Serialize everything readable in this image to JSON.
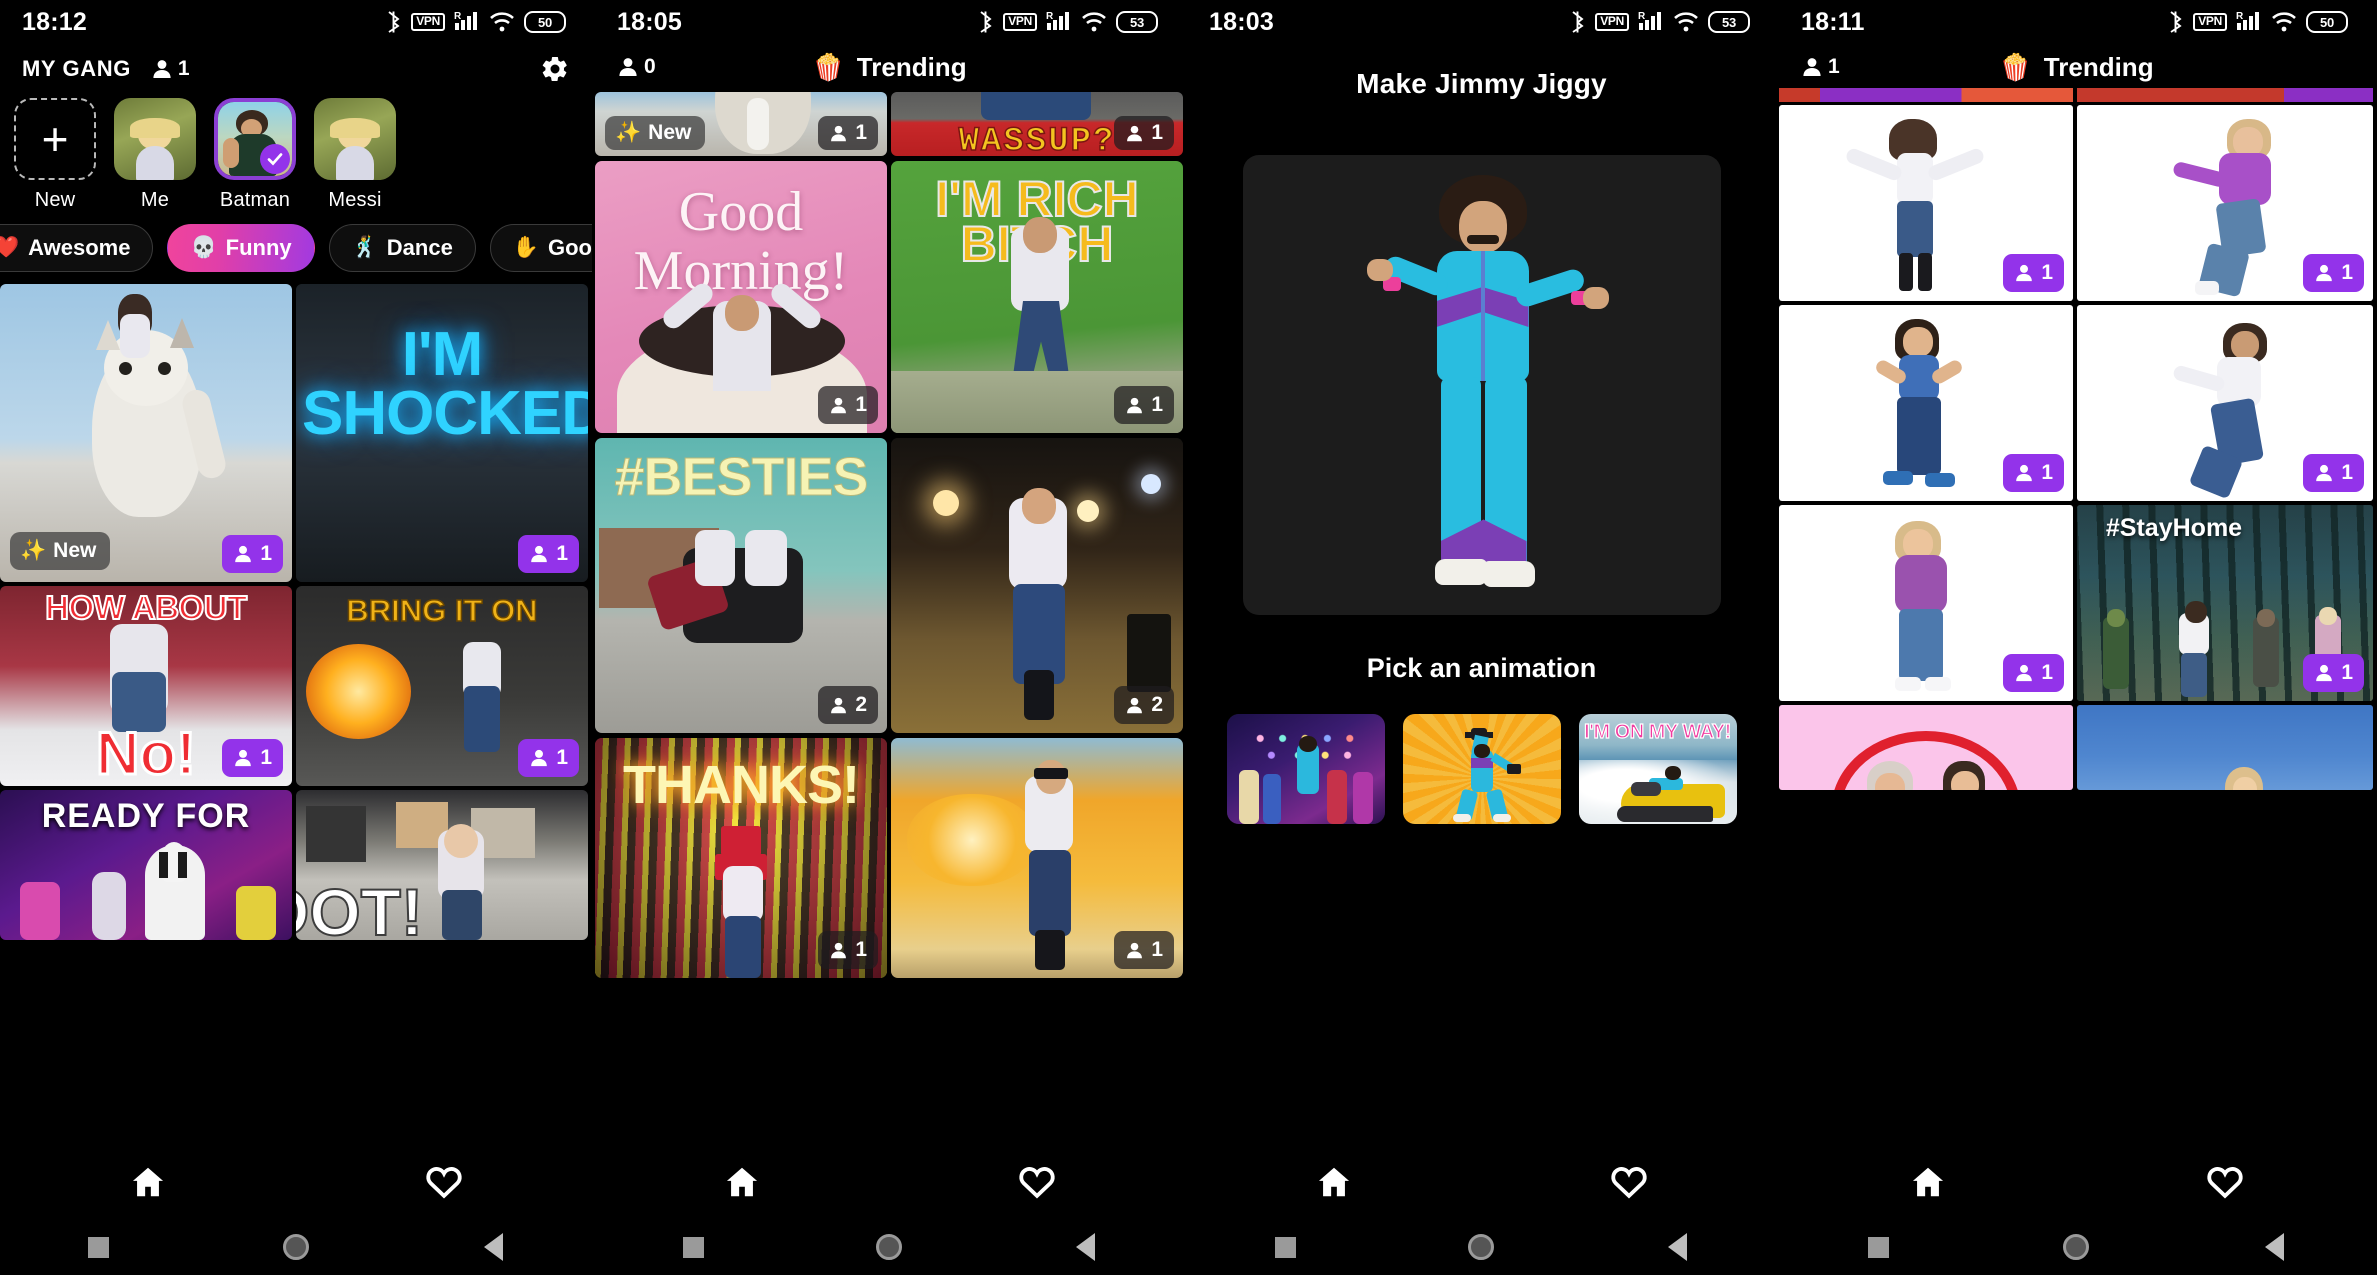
{
  "panels": [
    {
      "id": "my-gang",
      "statusbar": {
        "time": "18:12",
        "battery": "50",
        "vpn": "VPN",
        "roaming": "R",
        "icons": [
          "bluetooth-icon",
          "vpn-icon",
          "signal-icon",
          "wifi-icon",
          "battery-icon"
        ]
      },
      "header": {
        "title": "MY GANG",
        "member_count": "1",
        "gear": "gear-icon"
      },
      "avatars": [
        {
          "label": "New",
          "type": "add",
          "selected": false
        },
        {
          "label": "Me",
          "type": "photo",
          "selected": false
        },
        {
          "label": "Batman",
          "type": "photo",
          "selected": true
        },
        {
          "label": "Messi",
          "type": "photo",
          "selected": false
        }
      ],
      "chips": [
        {
          "label": "Awesome",
          "emoji": "❤️",
          "active": false
        },
        {
          "label": "Funny",
          "emoji": "💀",
          "active": true
        },
        {
          "label": "Dance",
          "emoji": "🕺",
          "active": false
        },
        {
          "label": "Good",
          "emoji": "✋",
          "active": false
        }
      ],
      "tiles": [
        {
          "caption": "",
          "scene": "cat-snow",
          "count": "1",
          "new": "New",
          "badge": "purple"
        },
        {
          "caption": "I'M SHOCKED",
          "scene": "neon-blue",
          "count": "1",
          "badge": "purple"
        },
        {
          "caption": "HOW ABOUT NO!",
          "scene": "wrestling",
          "count": "1",
          "badge": "purple"
        },
        {
          "caption": "BRING IT ON",
          "scene": "explosion-grey",
          "count": "1",
          "badge": "purple"
        },
        {
          "caption": "READY FOR",
          "scene": "zebra-party",
          "count": "",
          "badge": "none"
        },
        {
          "caption": "OOT!",
          "scene": "city-street",
          "count": "",
          "badge": "none"
        }
      ],
      "bottomnav": [
        {
          "icon": "home-icon",
          "active": true
        },
        {
          "icon": "heart-icon",
          "active": false
        }
      ]
    },
    {
      "id": "trending-a",
      "statusbar": {
        "time": "18:05",
        "battery": "53",
        "vpn": "VPN",
        "roaming": "R"
      },
      "header": {
        "member_count": "0",
        "title": "Trending",
        "emoji": "🍿"
      },
      "tiles": [
        {
          "caption": "",
          "scene": "penguin-snow",
          "count": "1",
          "new": "New",
          "badge": "dark"
        },
        {
          "caption": "WASSUP?",
          "scene": "red-wassup",
          "count": "1",
          "badge": "dark"
        },
        {
          "caption": "Good Morning!",
          "scene": "pink-mug",
          "count": "1",
          "badge": "dark"
        },
        {
          "caption": "I'M RICH BITCH",
          "scene": "green-money",
          "count": "1",
          "badge": "dark"
        },
        {
          "caption": "#BESTIES",
          "scene": "teal-motorcycle",
          "count": "2",
          "badge": "dark"
        },
        {
          "caption": "",
          "scene": "night-street",
          "count": "2",
          "badge": "dark"
        },
        {
          "caption": "THANKS!",
          "scene": "neon-stripes",
          "count": "1",
          "badge": "dark"
        },
        {
          "caption": "",
          "scene": "orange-blast",
          "count": "1",
          "badge": "dark"
        }
      ],
      "bottomnav": [
        {
          "icon": "home-icon",
          "active": true
        },
        {
          "icon": "heart-icon",
          "active": false
        }
      ]
    },
    {
      "id": "make-jimmy-jiggy",
      "statusbar": {
        "time": "18:03",
        "battery": "53",
        "vpn": "VPN",
        "roaming": "R"
      },
      "title": "Make Jimmy Jiggy",
      "preview": {
        "name": "jimmy-avatar",
        "outfit_colors": [
          "#29bde0",
          "#7b3fb5",
          "#ec3f9b"
        ]
      },
      "pick_label": "Pick an animation",
      "animations": [
        {
          "name": "disco-dance",
          "caption": ""
        },
        {
          "name": "dumbbell-lift",
          "caption": ""
        },
        {
          "name": "jetski",
          "caption": "I'M ON MY WAY!"
        }
      ],
      "bottomnav": [
        {
          "icon": "home-icon",
          "active": true
        },
        {
          "icon": "heart-icon",
          "active": false
        }
      ]
    },
    {
      "id": "trending-b",
      "statusbar": {
        "time": "18:11",
        "battery": "50",
        "vpn": "VPN",
        "roaming": "R"
      },
      "header": {
        "member_count": "1",
        "title": "Trending",
        "emoji": "🍿"
      },
      "tiles": [
        {
          "caption": "",
          "scene": "white-girl-arms-out",
          "count": "1",
          "badge": "purple"
        },
        {
          "caption": "",
          "scene": "white-girl-purple-top",
          "count": "1",
          "badge": "purple"
        },
        {
          "caption": "",
          "scene": "white-girl-blue-top",
          "count": "1",
          "badge": "purple"
        },
        {
          "caption": "",
          "scene": "white-girl-dance",
          "count": "1",
          "badge": "purple"
        },
        {
          "caption": "",
          "scene": "white-girl-purple-sweater",
          "count": "1",
          "badge": "purple"
        },
        {
          "caption": "#StayHome",
          "scene": "forest-zombies",
          "count": "1",
          "badge": "purple"
        },
        {
          "caption": "",
          "scene": "pink-heart-couple",
          "count": "",
          "badge": "none"
        },
        {
          "caption": "",
          "scene": "blue-sky",
          "count": "",
          "badge": "none"
        }
      ],
      "bottomnav": [
        {
          "icon": "home-icon",
          "active": true
        },
        {
          "icon": "heart-icon",
          "active": false
        }
      ]
    }
  ],
  "sysnav": {
    "recents": "square-icon",
    "home": "circle-icon",
    "back": "triangle-back-icon"
  },
  "colors": {
    "accent": "#9333ea",
    "chip_active_from": "#f0449c",
    "chip_active_to": "#a23ae0",
    "avatar_select_border": "#8b3fd4",
    "bg": "#000000"
  }
}
